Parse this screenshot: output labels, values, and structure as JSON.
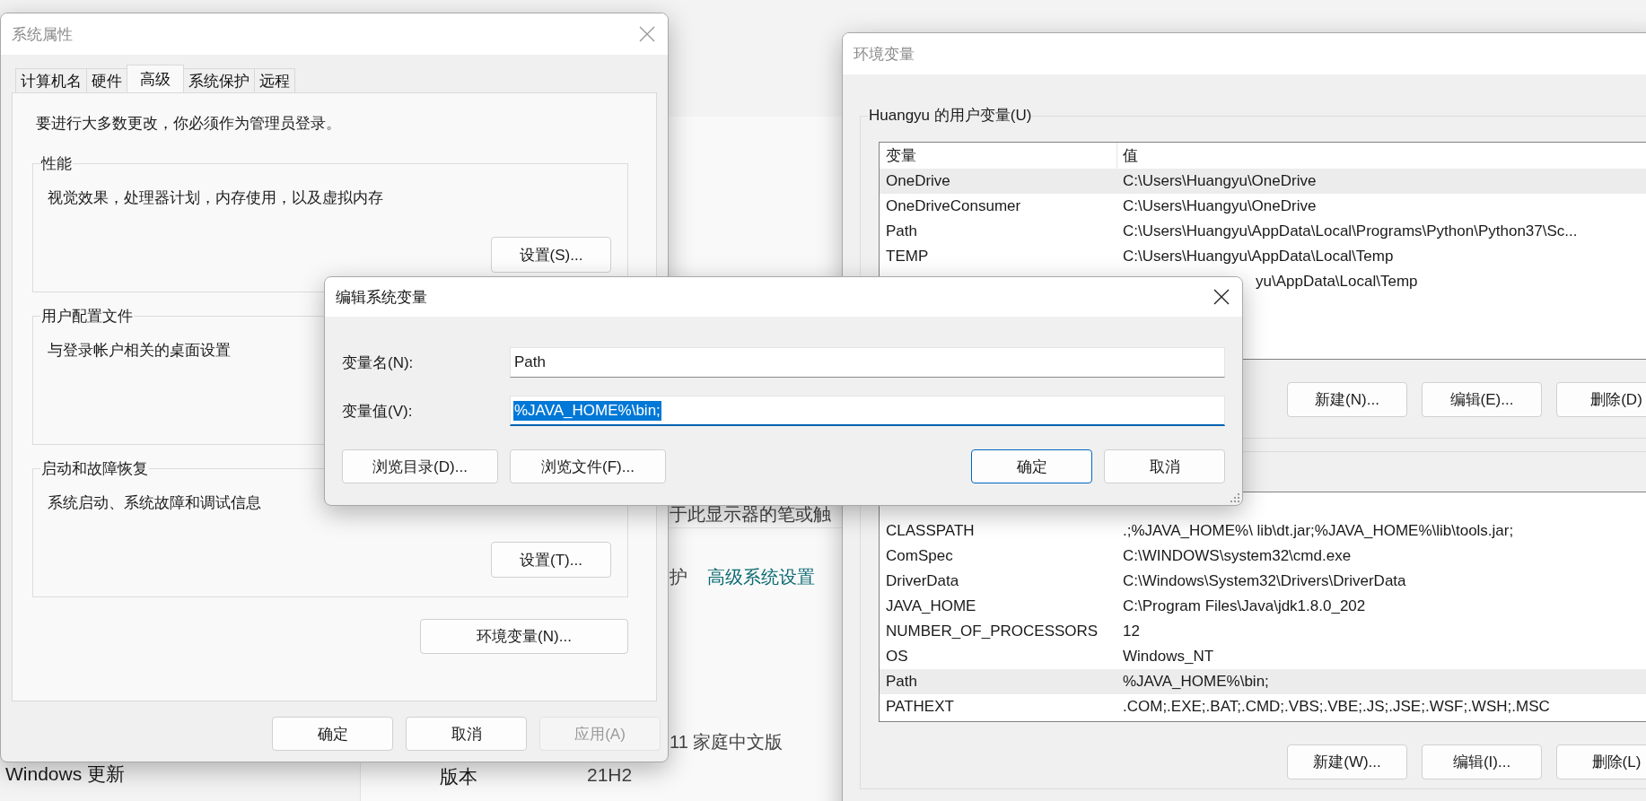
{
  "settings_window": {
    "nav_items": [
      {
        "label": "Windows 更新",
        "selected": false
      }
    ],
    "texts": [
      {
        "kind": "text",
        "text": "于此显示器的笔或触"
      },
      {
        "kind": "text",
        "text": "护"
      },
      {
        "kind": "link",
        "text": "高级系统设置"
      },
      {
        "kind": "text",
        "text": "11 家庭中文版"
      }
    ],
    "specs": [
      {
        "label": "版本",
        "value": "21H2"
      }
    ]
  },
  "system_properties": {
    "title": "系统属性",
    "active": false,
    "tabs": [
      {
        "label": "计算机名",
        "selected": false
      },
      {
        "label": "硬件",
        "selected": false
      },
      {
        "label": "高级",
        "selected": true
      },
      {
        "label": "系统保护",
        "selected": false
      },
      {
        "label": "远程",
        "selected": false
      }
    ],
    "notice": "要进行大多数更改，你必须作为管理员登录。",
    "groups": [
      {
        "title": "性能",
        "description": "视觉效果，处理器计划，内存使用，以及虚拟内存",
        "button": "设置(S)..."
      },
      {
        "title": "用户配置文件",
        "description": "与登录帐户相关的桌面设置"
      },
      {
        "title": "启动和故障恢复",
        "description": "系统启动、系统故障和调试信息",
        "button": "设置(T)..."
      }
    ],
    "env_button": "环境变量(N)...",
    "buttons": [
      {
        "label": "确定",
        "disabled": false
      },
      {
        "label": "取消",
        "disabled": false
      },
      {
        "label": "应用(A)",
        "disabled": true
      }
    ]
  },
  "environment_variables": {
    "title": "环境变量",
    "active": false,
    "user_group": {
      "label": "Huangyu 的用户变量(U)",
      "columns": [
        "变量",
        "值"
      ],
      "rows": [
        {
          "name": "OneDrive",
          "value": "C:\\Users\\Huangyu\\OneDrive",
          "selected": true
        },
        {
          "name": "OneDriveConsumer",
          "value": "C:\\Users\\Huangyu\\OneDrive",
          "selected": false
        },
        {
          "name": "Path",
          "value": "C:\\Users\\Huangyu\\AppData\\Local\\Programs\\Python\\Python37\\Sc...",
          "selected": false
        },
        {
          "name": "TEMP",
          "value": "C:\\Users\\Huangyu\\AppData\\Local\\Temp",
          "selected": false
        },
        {
          "value": "yu\\AppData\\Local\\Temp",
          "selected": false
        }
      ],
      "buttons": [
        "新建(N)...",
        "编辑(E)...",
        "删除(D)"
      ]
    },
    "system_group": {
      "rows": [
        {
          "name": "CLASSPATH",
          "value": ".;%JAVA_HOME%\\  lib\\dt.jar;%JAVA_HOME%\\lib\\tools.jar;",
          "selected": false
        },
        {
          "name": "ComSpec",
          "value": "C:\\WINDOWS\\system32\\cmd.exe",
          "selected": false
        },
        {
          "name": "DriverData",
          "value": "C:\\Windows\\System32\\Drivers\\DriverData",
          "selected": false
        },
        {
          "name": "JAVA_HOME",
          "value": "C:\\Program Files\\Java\\jdk1.8.0_202",
          "selected": false
        },
        {
          "name": "NUMBER_OF_PROCESSORS",
          "value": "12",
          "selected": false
        },
        {
          "name": "OS",
          "value": "Windows_NT",
          "selected": false
        },
        {
          "name": "Path",
          "value": "%JAVA_HOME%\\bin;",
          "selected": true
        },
        {
          "name": "PATHEXT",
          "value": ".COM;.EXE;.BAT;.CMD;.VBS;.VBE;.JS;.JSE;.WSF;.WSH;.MSC",
          "selected": false
        }
      ],
      "buttons": [
        "新建(W)...",
        "编辑(I)...",
        "删除(L)"
      ]
    }
  },
  "edit_dialog": {
    "title": "编辑系统变量",
    "active": true,
    "fields": [
      {
        "label": "变量名(N):",
        "value": "Path",
        "selected": false
      },
      {
        "label": "变量值(V):",
        "value": "%JAVA_HOME%\\bin;",
        "selected": true
      }
    ],
    "left_buttons": [
      "浏览目录(D)...",
      "浏览文件(F)..."
    ],
    "buttons": [
      {
        "label": "确定",
        "default": true
      },
      {
        "label": "取消",
        "default": false
      }
    ]
  }
}
